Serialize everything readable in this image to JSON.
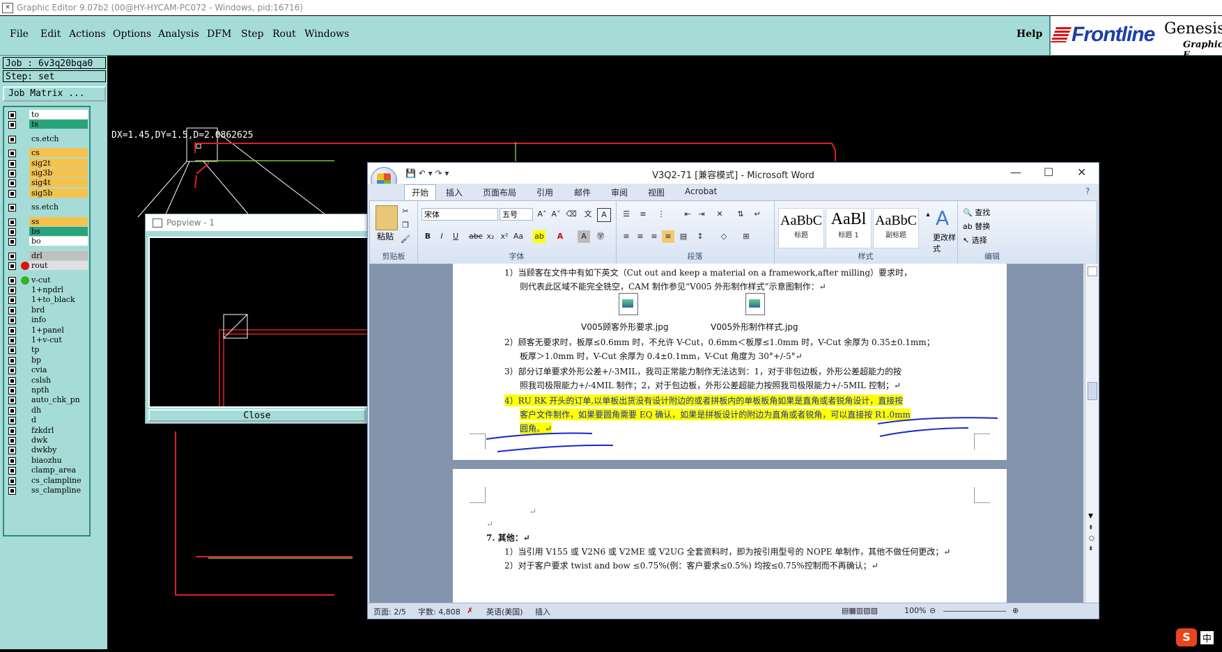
{
  "window": {
    "title": "Graphic Editor 9.07b2 (00@HY-HYCAM-PC072 - Windows, pid:16716)"
  },
  "menu": {
    "items": [
      "File",
      "Edit",
      "Actions",
      "Options",
      "Analysis",
      "DFM",
      "Step",
      "Rout",
      "Windows"
    ],
    "help": "Help"
  },
  "brand": {
    "logo": "Frontline",
    "product": "Genesis",
    "subtitle": "Graphic E"
  },
  "job": {
    "job_label": "Job  :  6v3q20bqa0",
    "step_label": "Step:  set",
    "matrix_button": "Job Matrix ..."
  },
  "layers": [
    {
      "name": "to",
      "color": "#ffffff"
    },
    {
      "name": "ts",
      "color": "#2aa37d"
    },
    {
      "name": "cs.etch",
      "color": "#a6dcd8"
    },
    {
      "name": "cs",
      "color": "#f5c24c"
    },
    {
      "name": "sig2t",
      "color": "#f5c24c"
    },
    {
      "name": "sig3b",
      "color": "#f5c24c"
    },
    {
      "name": "sig4t",
      "color": "#f5c24c"
    },
    {
      "name": "sig5b",
      "color": "#f5c24c"
    },
    {
      "name": "ss.etch",
      "color": "#a6dcd8"
    },
    {
      "name": "ss",
      "color": "#f5c24c"
    },
    {
      "name": "bs",
      "color": "#2aa37d"
    },
    {
      "name": "bo",
      "color": "#ffffff"
    },
    {
      "name": "drl",
      "color": "#c0c0c0"
    },
    {
      "name": "rout",
      "color": "#e0e0e0"
    },
    {
      "name": "v-cut",
      "color": "#a6dcd8"
    },
    {
      "name": "1+npdrl",
      "color": "#a6dcd8"
    },
    {
      "name": "1+to_black",
      "color": "#a6dcd8"
    },
    {
      "name": "brd",
      "color": "#a6dcd8"
    },
    {
      "name": "info",
      "color": "#a6dcd8"
    },
    {
      "name": "1+panel",
      "color": "#a6dcd8"
    },
    {
      "name": "1+v-cut",
      "color": "#a6dcd8"
    },
    {
      "name": "tp",
      "color": "#a6dcd8"
    },
    {
      "name": "bp",
      "color": "#a6dcd8"
    },
    {
      "name": "cvia",
      "color": "#a6dcd8"
    },
    {
      "name": "cslsh",
      "color": "#a6dcd8"
    },
    {
      "name": "npth",
      "color": "#a6dcd8"
    },
    {
      "name": "auto_chk_pn",
      "color": "#a6dcd8"
    },
    {
      "name": "dh",
      "color": "#a6dcd8"
    },
    {
      "name": "d",
      "color": "#a6dcd8"
    },
    {
      "name": "fzkdrl",
      "color": "#a6dcd8"
    },
    {
      "name": "dwk",
      "color": "#a6dcd8"
    },
    {
      "name": "dwkby",
      "color": "#a6dcd8"
    },
    {
      "name": "biaozhu",
      "color": "#a6dcd8"
    },
    {
      "name": "clamp_area",
      "color": "#a6dcd8"
    },
    {
      "name": "cs_clampline",
      "color": "#a6dcd8"
    },
    {
      "name": "ss_clampline",
      "color": "#a6dcd8"
    }
  ],
  "canvas": {
    "measure": "DX=1.45,DY=1.5,D=2.0862625"
  },
  "popview": {
    "title": "Popview - 1",
    "close": "Close"
  },
  "word": {
    "title": "V3Q2-71 [兼容模式] - Microsoft Word",
    "tabs": [
      "开始",
      "插入",
      "页面布局",
      "引用",
      "邮件",
      "审阅",
      "视图",
      "Acrobat"
    ],
    "font_name": "宋体",
    "font_size": "五号",
    "groups": {
      "clipboard": "剪贴板",
      "font": "字体",
      "paragraph": "段落",
      "styles": "样式",
      "editing": "编辑"
    },
    "paste": "粘贴",
    "styles": [
      {
        "sample": "AaBbC",
        "name": "标题"
      },
      {
        "sample": "AaBl",
        "name": "标题 1"
      },
      {
        "sample": "AaBbC",
        "name": "副标题"
      }
    ],
    "change_styles": "更改样式",
    "find": "查找",
    "replace": "替换",
    "select": "选择",
    "doc": {
      "l1a": "1）当顾客在文件中有如下英文（Cut out and keep a material on a framework,after milling）要求时，",
      "l1b": "则代表此区域不能完全铣空，CAM 制作参见“V005 外形制作样式”示意图制作：↵",
      "file1": "V005顾客外形要求.jpg",
      "file2": "V005外形制作样式.jpg",
      "l2a": "2）顾客无要求时，板厚≤0.6mm 时，不允许 V-Cut，0.6mm＜板厚≤1.0mm 时，V-Cut 余厚为 0.35±0.1mm；",
      "l2b": "板厚＞1.0mm 时，V-Cut 余厚为 0.4±0.1mm，V-Cut 角度为 30°+/-5°↵",
      "l3a": "3）部分订单要求外形公差+/-3MIL，我司正常能力制作无法达到：1，对于非包边板，外形公差超能力的按",
      "l3b": "照我司极限能力+/-4MIL 制作；2，对于包边板，外形公差超能力按照我司极限能力+/-5MIL 控制；↵",
      "l4a": "4）RU RK 开头的订单,以单板出货没有设计附边的或者拼板内的单板板角如果是直角或者锐角设计，直接按",
      "l4b": "客户文件制作，如果要圆角需要 EQ 确认，如果是拼板设计的附边为直角或者锐角，可以直接按 R1.0mm",
      "l4c": "圆角。↵",
      "p2l0": "↵",
      "p2l1": "↵",
      "p2head": "7.  其他：↵",
      "p2l2": "1）当引用 V155 或 V2N6 或 V2ME 或 V2UG 全套资料时，即为按引用型号的 NOPE 单制作，其他不做任何更改；↵",
      "p2l3": "2）对于客户要求 twist and bow ≤0.75%(例：客户要求≤0.5%) 均按≤0.75%控制而不再确认；↵"
    },
    "status": {
      "page": "页面: 2/5",
      "words": "字数: 4,808",
      "lang": "英语(美国)",
      "insert": "插入",
      "zoom": "100%"
    }
  },
  "ime": {
    "logo": "S",
    "mode": "中"
  }
}
